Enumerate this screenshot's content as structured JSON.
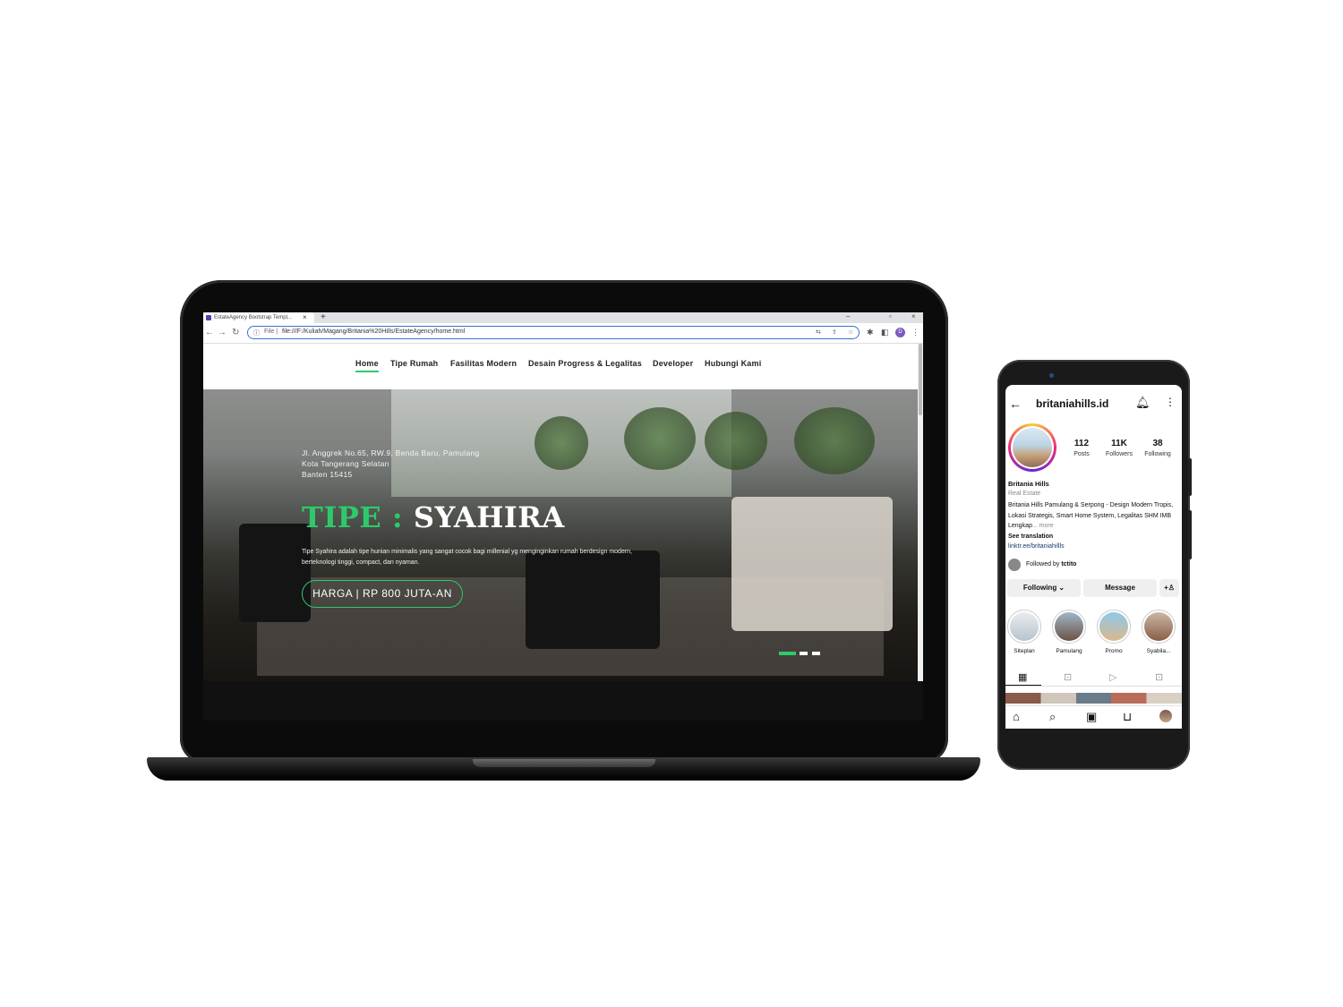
{
  "browser": {
    "tab_title": "EstateAgency Bootstrap Templ...",
    "tab_close": "×",
    "tab_new": "+",
    "omnibox_info": "ⓘ",
    "omnibox_file": "File |",
    "url": "file:///F:/Kuliah/Magang/Britania%20Hills/EstateAgency/home.html",
    "profile_initial": "D"
  },
  "site": {
    "nav": [
      "Home",
      "Tipe Rumah",
      "Fasilitas Modern",
      "Desain Progress & Legalitas",
      "Developer",
      "Hubungi Kami"
    ],
    "accent_color": "#2eca6a",
    "hero": {
      "address_line1": "Jl. Anggrek No.65, RW.9, Benda Baru, Pamulang",
      "address_line2": "Kota Tangerang Selatan",
      "address_line3": "Banten 15415",
      "title_prefix": "TIPE :",
      "title_name": "SYAHIRA",
      "description": "Tipe Syahira adalah tipe hunian minimalis yang sangat cocok bagi millenial yg menginginkan rumah berdesign modern, berteknologi tinggi, compact, dan nyaman.",
      "button_label": "HARGA | RP 800 JUTA-AN",
      "carousel_active_index": 0,
      "carousel_count": 3
    }
  },
  "instagram": {
    "username": "britaniahills.id",
    "stats": [
      {
        "num": "112",
        "label": "Posts"
      },
      {
        "num": "11K",
        "label": "Followers"
      },
      {
        "num": "38",
        "label": "Following"
      }
    ],
    "name": "Britania Hills",
    "category": "Real Estate",
    "bio": "Britania Hills Pamulang & Serpong - Design Modern Tropis, Lokasi Strategis, Smart Home System, Legalitas SHM IMB Lengkap",
    "bio_more": "... more",
    "see_translation": "See translation",
    "link": "linktr.ee/britaniahillls",
    "followed_by_prefix": "Followed by",
    "followed_by_user": "tctito",
    "buttons": {
      "following": "Following ⌄",
      "message": "Message",
      "add_user": "+♙"
    },
    "highlights": [
      "Siteplan",
      "Pamulang",
      "Promo",
      "Syabila..."
    ]
  }
}
